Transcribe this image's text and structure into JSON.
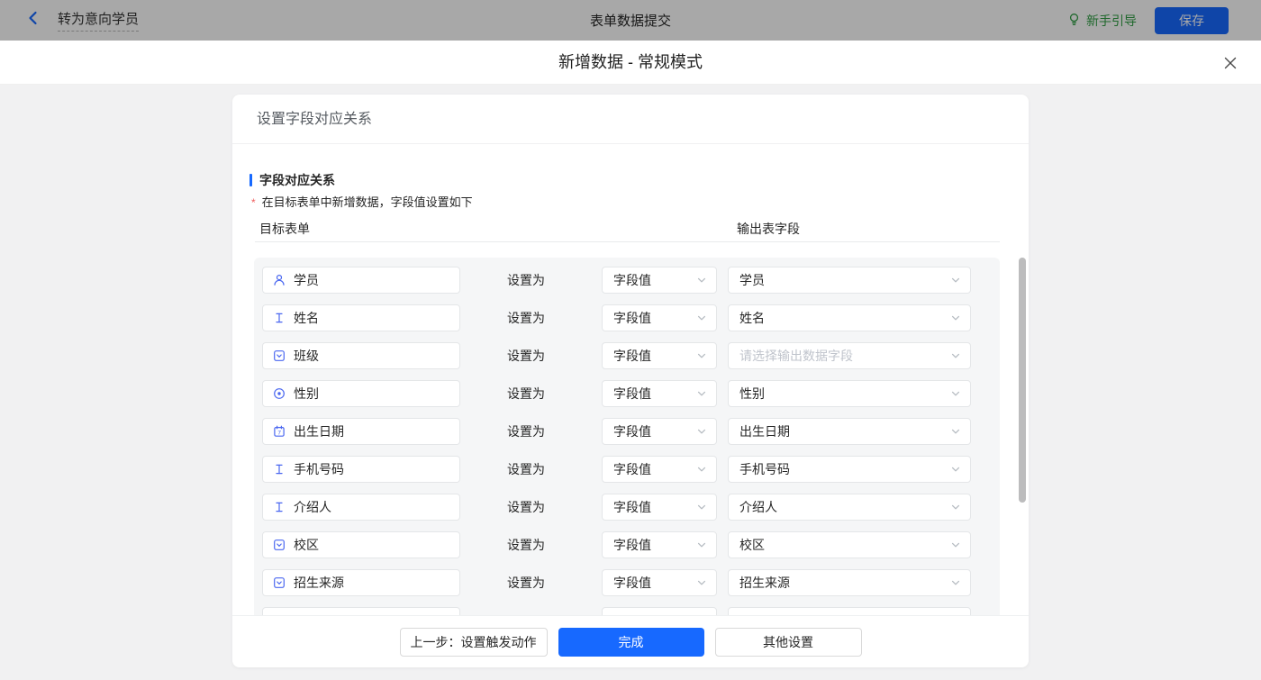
{
  "topbar": {
    "back_label": "转为意向学员",
    "title": "表单数据提交",
    "guide_label": "新手引导",
    "save_label": "保存"
  },
  "modal": {
    "title": "新增数据 - 常规模式",
    "card_title": "设置字段对应关系",
    "section_title": "字段对应关系",
    "required_mark": "*",
    "section_note": "在目标表单中新增数据，字段值设置如下",
    "col_left": "目标表单",
    "col_right": "输出表字段",
    "set_as_label": "设置为",
    "rows": [
      {
        "field": "学员",
        "icon": "member",
        "op": "字段值",
        "output": "学员",
        "is_placeholder": false
      },
      {
        "field": "姓名",
        "icon": "text",
        "op": "字段值",
        "output": "姓名",
        "is_placeholder": false
      },
      {
        "field": "班级",
        "icon": "select",
        "op": "字段值",
        "output": "请选择输出数据字段",
        "is_placeholder": true
      },
      {
        "field": "性别",
        "icon": "radio",
        "op": "字段值",
        "output": "性别",
        "is_placeholder": false
      },
      {
        "field": "出生日期",
        "icon": "date",
        "op": "字段值",
        "output": "出生日期",
        "is_placeholder": false
      },
      {
        "field": "手机号码",
        "icon": "text",
        "op": "字段值",
        "output": "手机号码",
        "is_placeholder": false
      },
      {
        "field": "介绍人",
        "icon": "text",
        "op": "字段值",
        "output": "介绍人",
        "is_placeholder": false
      },
      {
        "field": "校区",
        "icon": "select",
        "op": "字段值",
        "output": "校区",
        "is_placeholder": false
      },
      {
        "field": "招生来源",
        "icon": "select",
        "op": "字段值",
        "output": "招生来源",
        "is_placeholder": false
      }
    ],
    "footer": {
      "prev_label": "上一步：设置触发动作",
      "done_label": "完成",
      "other_label": "其他设置"
    }
  },
  "colors": {
    "accent_blue": "#1769ff",
    "icon_blue": "#4a67f0",
    "guide_green": "#2f9e44",
    "placeholder_gray": "#c0c4cc",
    "dim_overlay": "rgba(0,0,0,0.34)"
  }
}
